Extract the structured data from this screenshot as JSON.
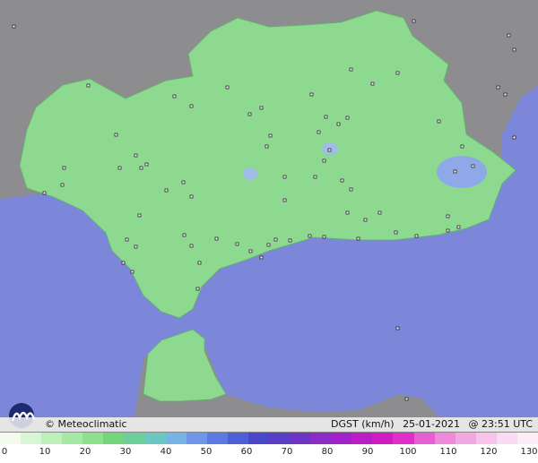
{
  "credit": "© Meteoclimatic",
  "variable": "DGST (km/h)",
  "date": "25-01-2021",
  "time": "@ 23:51 UTC",
  "colors": {
    "sea": "#7d87d9",
    "land_out": "#8d8d8f",
    "land_in": "#8cd98f",
    "land_in_dark": "#7fcf86",
    "gust_blue": "#8fa9e8"
  },
  "legend": {
    "ticks": [
      "0",
      "10",
      "20",
      "30",
      "40",
      "50",
      "60",
      "70",
      "80",
      "90",
      "100",
      "110",
      "120",
      "130"
    ],
    "colors": [
      "#f3fbef",
      "#d9f6d4",
      "#bff0bb",
      "#a6e9a4",
      "#8de08e",
      "#73d67a",
      "#6fcf9a",
      "#6cc6c2",
      "#78b3e6",
      "#6e95e8",
      "#5c78e2",
      "#4c5fd8",
      "#4a47cc",
      "#5a3fc6",
      "#6f34c4",
      "#8a2cc6",
      "#a221c8",
      "#bc1cc8",
      "#d21bc3",
      "#e02fc9",
      "#e85fd3",
      "#ee8ad9",
      "#f2a9e2",
      "#f6c4ea",
      "#f9dcf2",
      "#fcecf8"
    ]
  }
}
